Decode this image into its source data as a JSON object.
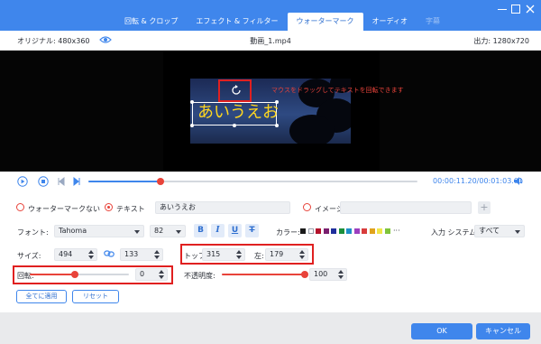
{
  "tabs": [
    {
      "label": "回転 & クロップ",
      "state": "normal"
    },
    {
      "label": "エフェクト & フィルター",
      "state": "normal"
    },
    {
      "label": "ウォーターマーク",
      "state": "active"
    },
    {
      "label": "オーディオ",
      "state": "normal"
    },
    {
      "label": "字幕",
      "state": "disabled"
    }
  ],
  "info": {
    "original": "オリジナル: 480x360",
    "filename": "動画_1.mp4",
    "output": "出力: 1280x720"
  },
  "preview": {
    "watermark_text": "あいうえお",
    "rotate_note": "マウスをドラッグしてテキストを回転できます"
  },
  "player": {
    "time": "00:00:11.20/00:01:03.01",
    "progress": 0.22
  },
  "watermark_options": {
    "none_label": "ウォーターマークない",
    "text_label": "テキスト",
    "text_value": "あいうえお",
    "image_label": "イメージ",
    "image_value": "",
    "plus_label": "+",
    "selected": "text"
  },
  "font_row": {
    "font_label": "フォント:",
    "font_value": "Tahoma",
    "size_value": "82",
    "bold_label": "B",
    "italic_label": "I",
    "underline_label": "U",
    "strike_label": "T",
    "color_label": "カラー:",
    "more_label": "···",
    "input_system_label": "入力 システム:",
    "input_system_value": "すべて"
  },
  "colors": [
    "#1a1a1a",
    "#ffffff",
    "#b3122a",
    "#7a1f6e",
    "#1f2f9c",
    "#1c8f3a",
    "#1e8fc7",
    "#9c3fbf",
    "#d83c3c",
    "#e0a31c",
    "#f0e64a",
    "#7fc43b"
  ],
  "size_row": {
    "size_label": "サイズ:",
    "width_value": "494",
    "height_value": "133",
    "top_label": "トップ:",
    "top_value": "315",
    "left_label": "左:",
    "left_value": "179"
  },
  "rotate_row": {
    "rotate_label": "回転:",
    "rotate_value": "0",
    "rotate_position": 0.45,
    "opacity_label": "不透明度:",
    "opacity_value": "100",
    "opacity_position": 1.0
  },
  "actions": {
    "apply_all": "全てに適用",
    "reset": "リセット",
    "ok": "OK",
    "cancel": "キャンセル"
  }
}
